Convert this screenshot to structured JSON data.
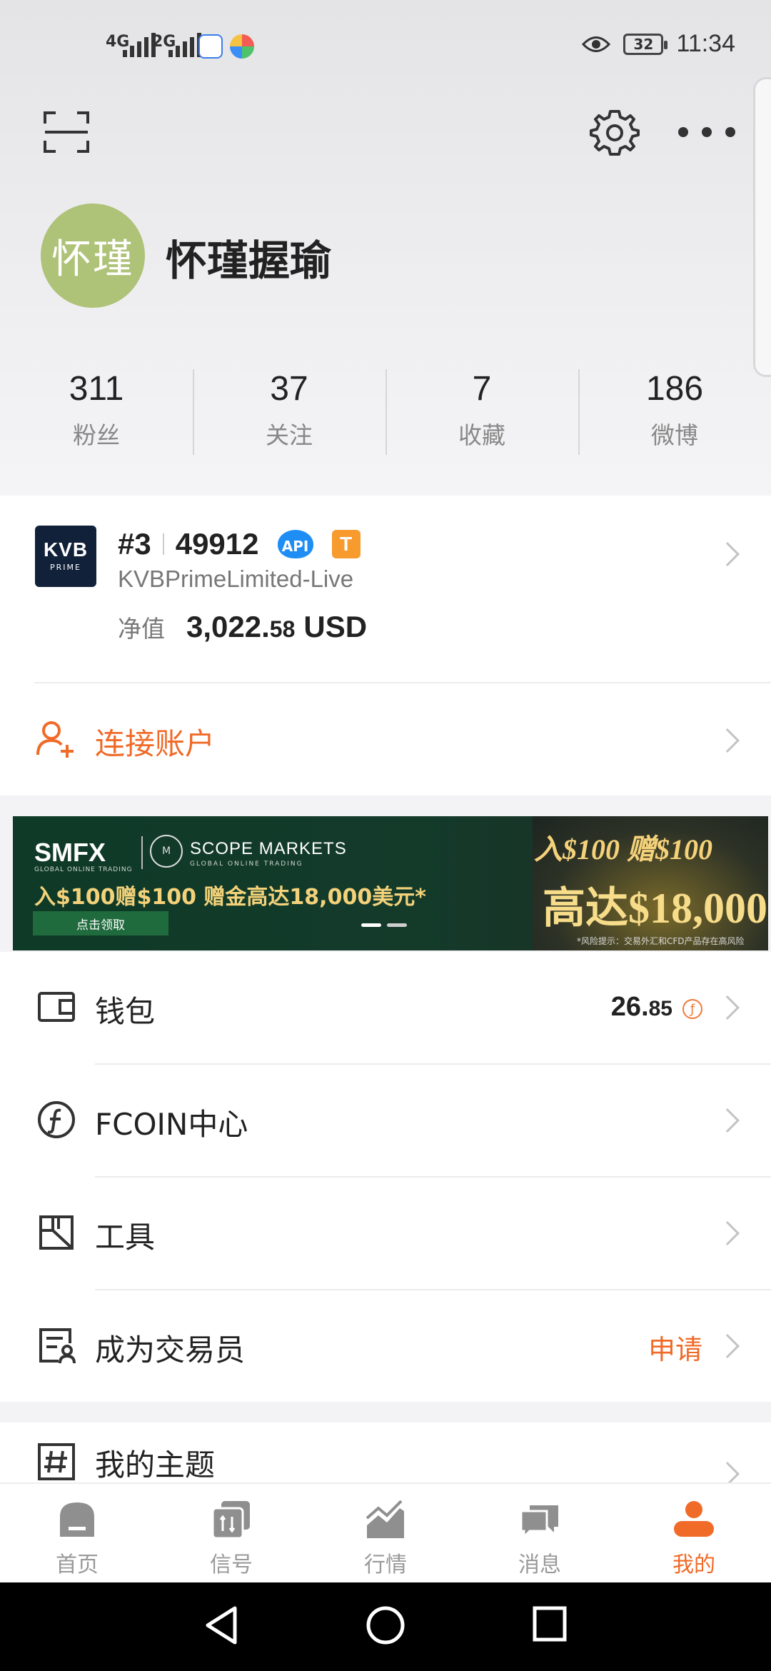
{
  "status_bar": {
    "net1": "4G",
    "net2": "2G",
    "battery": "32",
    "time": "11:34"
  },
  "profile": {
    "avatar_text": "怀瑾",
    "name": "怀瑾握瑜"
  },
  "stats": [
    {
      "value": "311",
      "label": "粉丝"
    },
    {
      "value": "37",
      "label": "关注"
    },
    {
      "value": "7",
      "label": "收藏"
    },
    {
      "value": "186",
      "label": "微博"
    }
  ],
  "account": {
    "logo_main": "KVB",
    "logo_sub": "PRIME",
    "rank": "#3",
    "number": "49912",
    "api_badge": "API",
    "t_badge": "T",
    "broker": "KVBPrimeLimited-Live",
    "equity_label": "净值",
    "equity_int": "3,022.",
    "equity_dec": "58",
    "equity_currency": "USD",
    "connect_label": "连接账户"
  },
  "banner": {
    "smfx": "SMFX",
    "smfx_sub": "GLOBAL ONLINE TRADING",
    "scope": "SCOPE MARKETS",
    "scope_sub": "GLOBAL ONLINE TRADING",
    "headline": "入$100赠$100  赠金高达18,000美元*",
    "claim": "点击领取",
    "promo_line1": "入$100 赠$100",
    "promo_line2": "高达$18,000",
    "risk_note": "*风险提示：交易外汇和CFD产品存在高风险"
  },
  "menu": {
    "wallet": {
      "label": "钱包",
      "value_int": "26.",
      "value_dec": "85",
      "coin_symbol": "ƒ"
    },
    "fcoin": {
      "label": "FCOIN中心"
    },
    "tools": {
      "label": "工具"
    },
    "trader": {
      "label": "成为交易员",
      "action": "申请"
    },
    "topics": {
      "label": "我的主题"
    }
  },
  "nav": [
    {
      "label": "首页"
    },
    {
      "label": "信号"
    },
    {
      "label": "行情"
    },
    {
      "label": "消息"
    },
    {
      "label": "我的"
    }
  ],
  "colors": {
    "accent": "#f06a28",
    "avatar_bg": "#aec278",
    "api_blue": "#1e8ef5",
    "t_orange": "#f79b2e"
  }
}
